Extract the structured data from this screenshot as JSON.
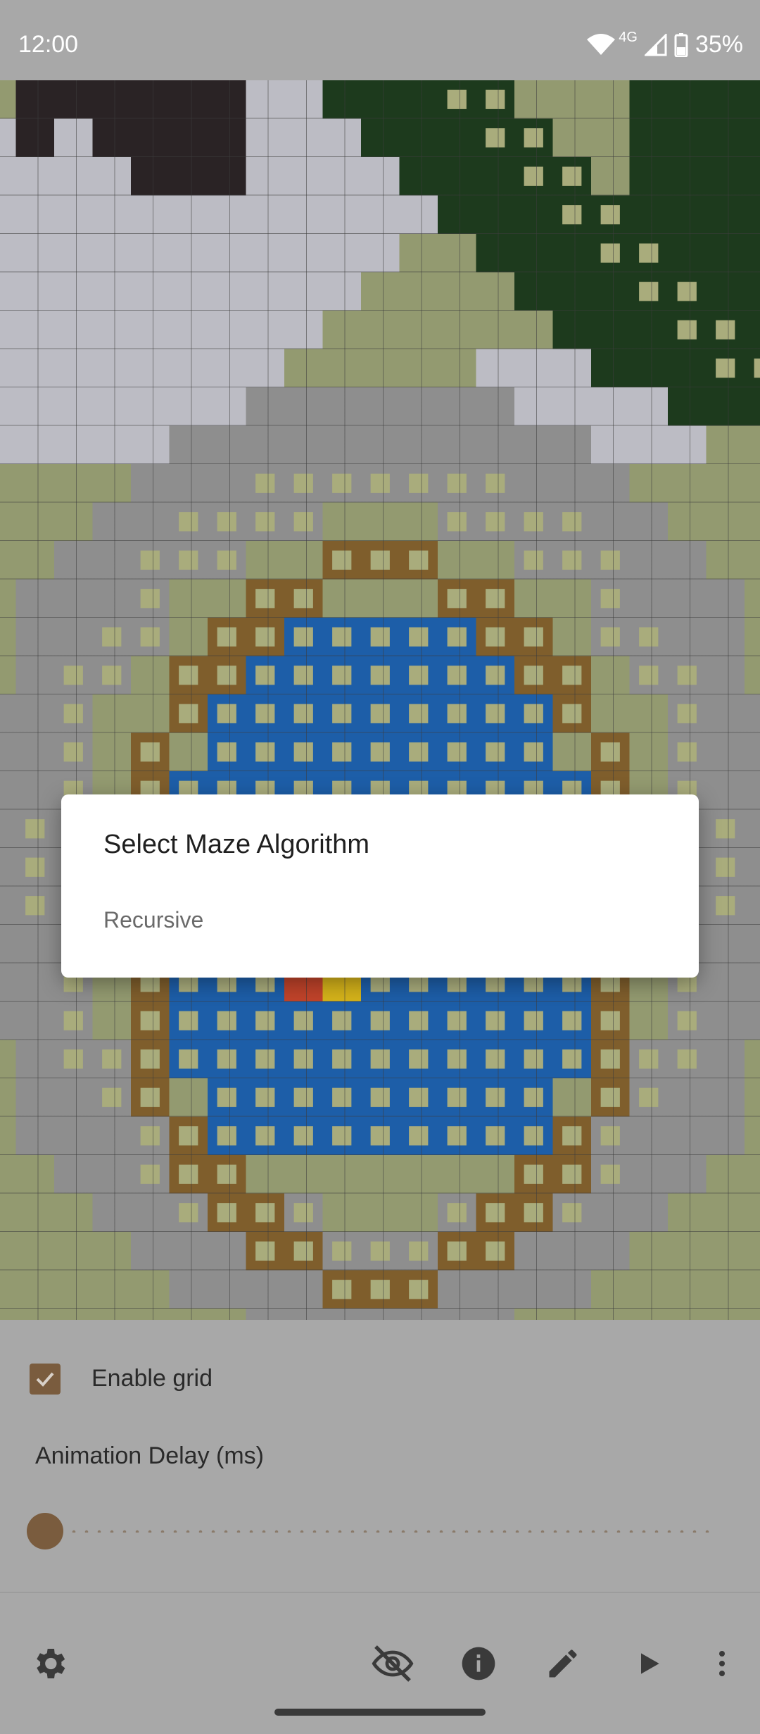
{
  "status_bar": {
    "time": "12:00",
    "network": "4G",
    "battery": "35%"
  },
  "maze": {
    "colors": {
      "grass": "#939a70",
      "wall": "#7f5e2c",
      "water": "#1d5ea8",
      "forest": "#1d3a1d",
      "dark": "#2a2325",
      "light": "#bcbcc4",
      "stone": "#8e8e8e",
      "marker": "#a9ac7c",
      "start": "#c0432a",
      "end": "#d4b21a"
    }
  },
  "dialog": {
    "title": "Select Maze Algorithm",
    "options": [
      "Recursive"
    ]
  },
  "settings": {
    "grid_checkbox_checked": true,
    "grid_label": "Enable grid",
    "delay_label": "Animation Delay (ms)",
    "delay_fraction": 0.0
  },
  "toolbar": {
    "icons": [
      "gear-icon",
      "visibility-off-icon",
      "info-icon",
      "edit-icon",
      "play-icon",
      "more-vert-icon"
    ]
  }
}
